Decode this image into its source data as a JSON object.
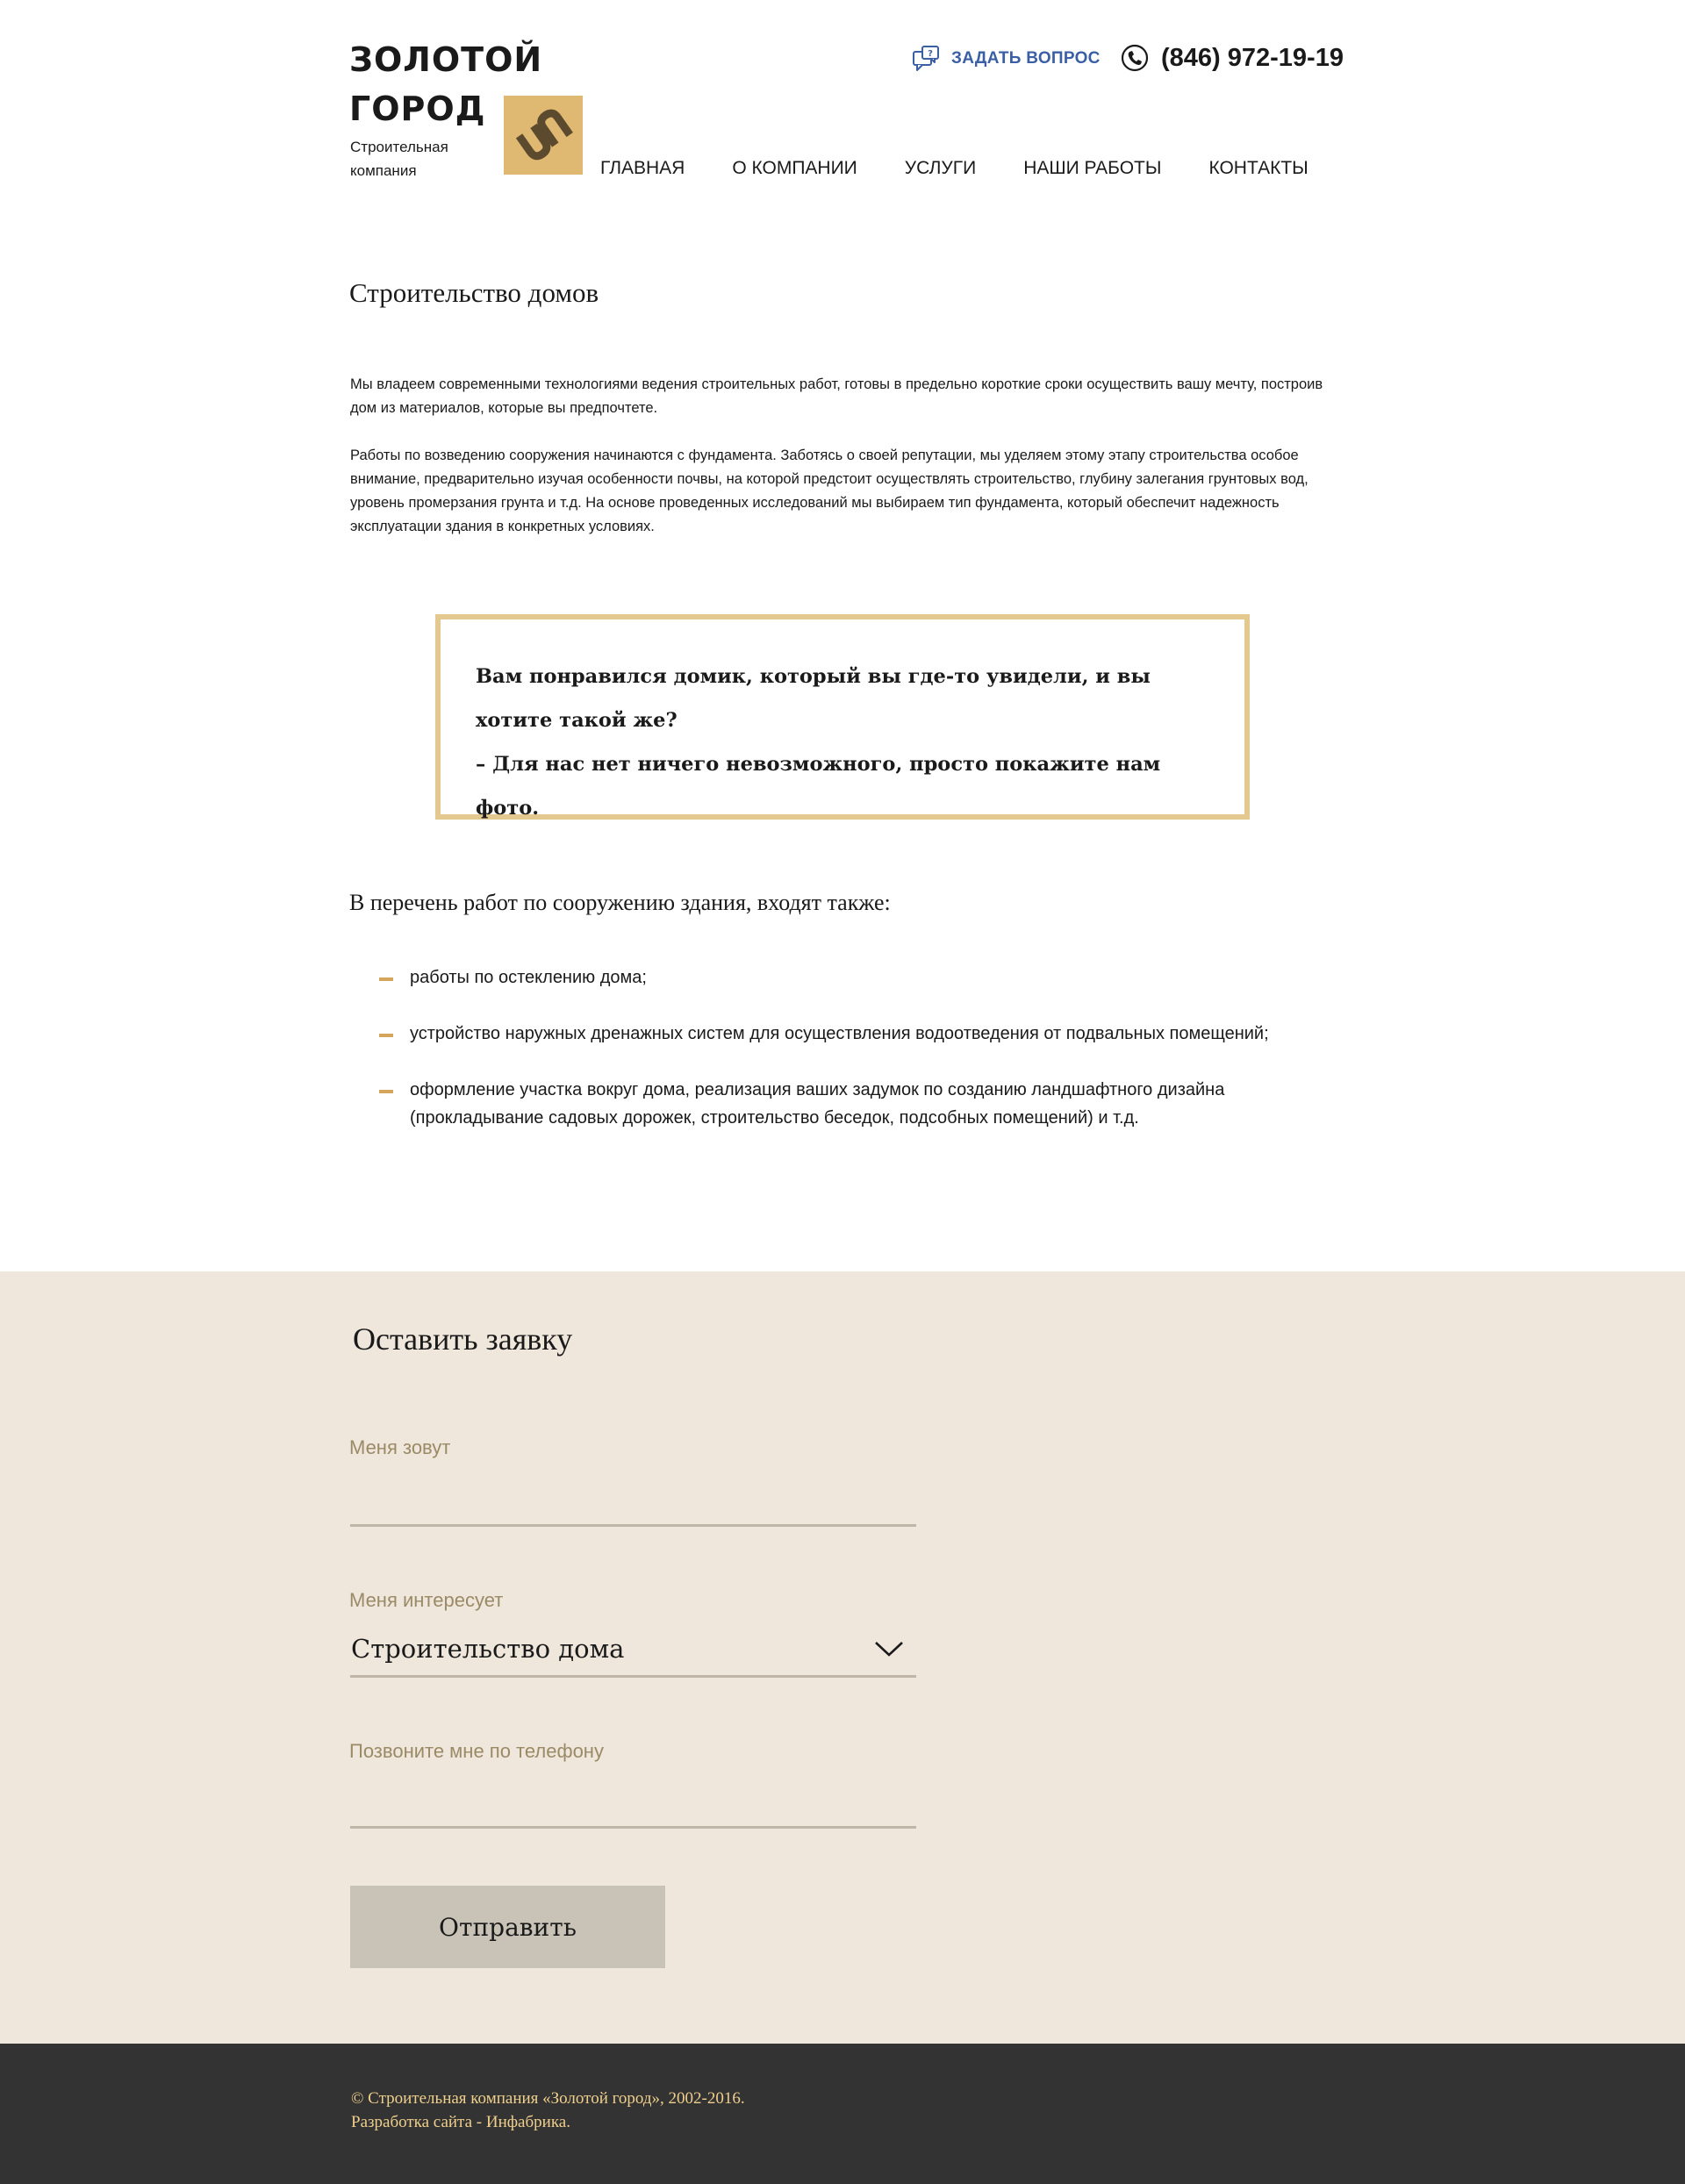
{
  "header": {
    "brand_line1": "ЗОЛОТОЙ",
    "brand_line2": "ГОРОД",
    "brand_sub_line1": "Строительная",
    "brand_sub_line2": "компания",
    "ask_label": "ЗАДАТЬ ВОПРОС",
    "ask_icon": "chat-question-icon",
    "phone": "(846) 972-19-19",
    "phone_icon": "phone-icon",
    "accent_color": "#dfb871",
    "link_color": "#3a5fa4"
  },
  "nav": {
    "items": [
      {
        "label": "ГЛАВНАЯ"
      },
      {
        "label": "О КОМПАНИИ"
      },
      {
        "label": "УСЛУГИ"
      },
      {
        "label": "НАШИ РАБОТЫ"
      },
      {
        "label": "КОНТАКТЫ"
      }
    ]
  },
  "content": {
    "title": "Строительство домов",
    "paragraph1": "Мы владеем современными технологиями ведения строительных работ, готовы в предельно короткие сроки осуществить вашу мечту, построив дом из материалов, которые вы предпочтете.",
    "paragraph2": "Работы по возведению сооружения начинаются с фундамента. Заботясь о своей репутации, мы уделяем этому этапу строительства особое внимание, предварительно изучая особенности почвы, на которой предстоит осуществлять строительство, глубину залегания грунтовых вод, уровень промерзания грунта и т.д. На основе проведенных исследований мы выбираем тип фундамента, который обеспечит надежность эксплуатации здания в конкретных условиях.",
    "quote_line1": "Вам понравился домик, который вы где-то увидели, и вы хотите такой же?",
    "quote_line2": "– Для нас нет ничего невозможного, просто покажите нам фото.",
    "list_title": "В перечень работ по сооружению здания, входят также:",
    "list_items": [
      "работы по остеклению дома;",
      "устройство наружных дренажных систем для осуществления водоотведения от подвальных помещений;",
      "оформление участка вокруг дома, реализация ваших задумок по созданию ландшафтного дизайна (прокладывание садовых дорожек, строительство беседок, подсобных помещений) и т.д."
    ]
  },
  "form": {
    "title": "Оставить заявку",
    "name_label": "Меня зовут",
    "name_value": "",
    "interest_label": "Меня интересует",
    "interest_value": "Строительство дома",
    "phone_label": "Позвоните мне по телефону",
    "phone_value": "",
    "submit_label": "Отправить",
    "background": "#efe7dc"
  },
  "footer": {
    "line1": "© Строительная компания «Золотой город», 2002-2016.",
    "line2": "Разработка сайта - Инфабрика.",
    "background": "#333333",
    "text_color": "#efcf8c"
  }
}
